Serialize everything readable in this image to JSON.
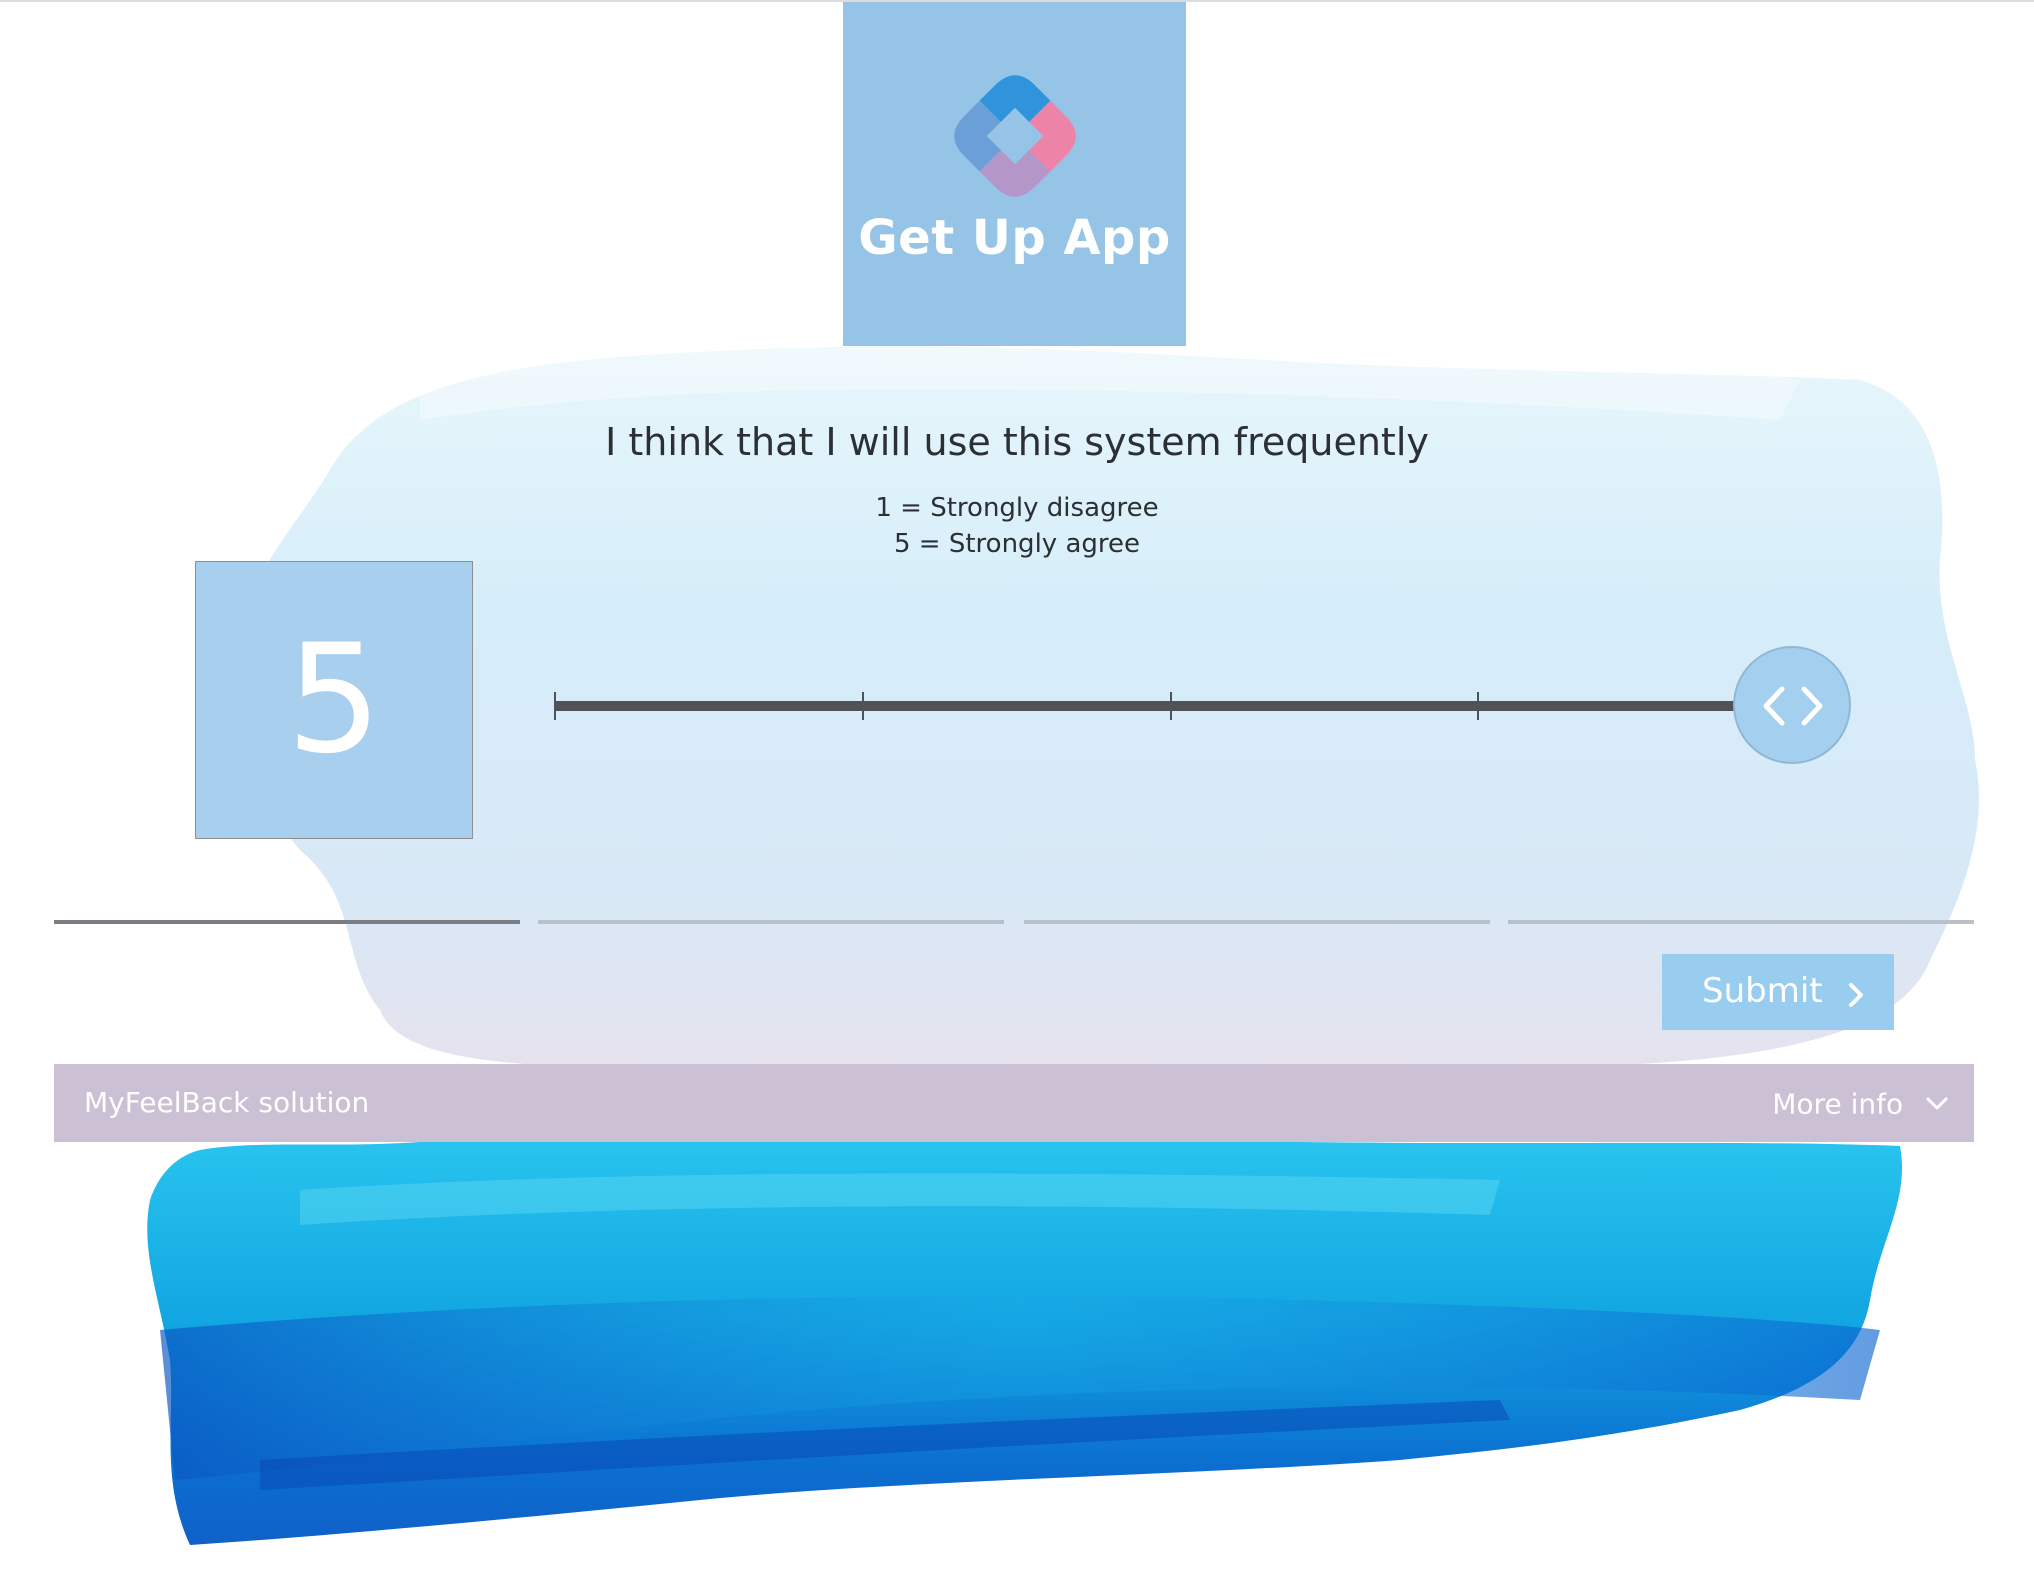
{
  "brand": {
    "logo_text": "Get Up App"
  },
  "survey": {
    "question": "I think that I will use this system frequently",
    "scale_min_label": "1 = Strongly disagree",
    "scale_max_label": "5 = Strongly agree",
    "value": "5",
    "slider": {
      "min": 1,
      "max": 5,
      "value": 5
    },
    "progress": {
      "steps": 4,
      "current_step": 1
    }
  },
  "actions": {
    "submit_label": "Submit"
  },
  "footer": {
    "brand_label": "MyFeelBack solution",
    "more_info_label": "More info"
  },
  "icons": {
    "logo": "logo-mark-icon",
    "slider_handle": "left-right-arrows-icon",
    "submit": "chevron-right-icon",
    "more_info": "chevron-down-icon"
  },
  "colors": {
    "accent": "#99cdef",
    "logo_background": "#95c4e6",
    "value_box": "#a8cfee",
    "footer_bar": "#cbc0d4",
    "slider_track": "#4f5257",
    "text": "#2c2f34"
  }
}
